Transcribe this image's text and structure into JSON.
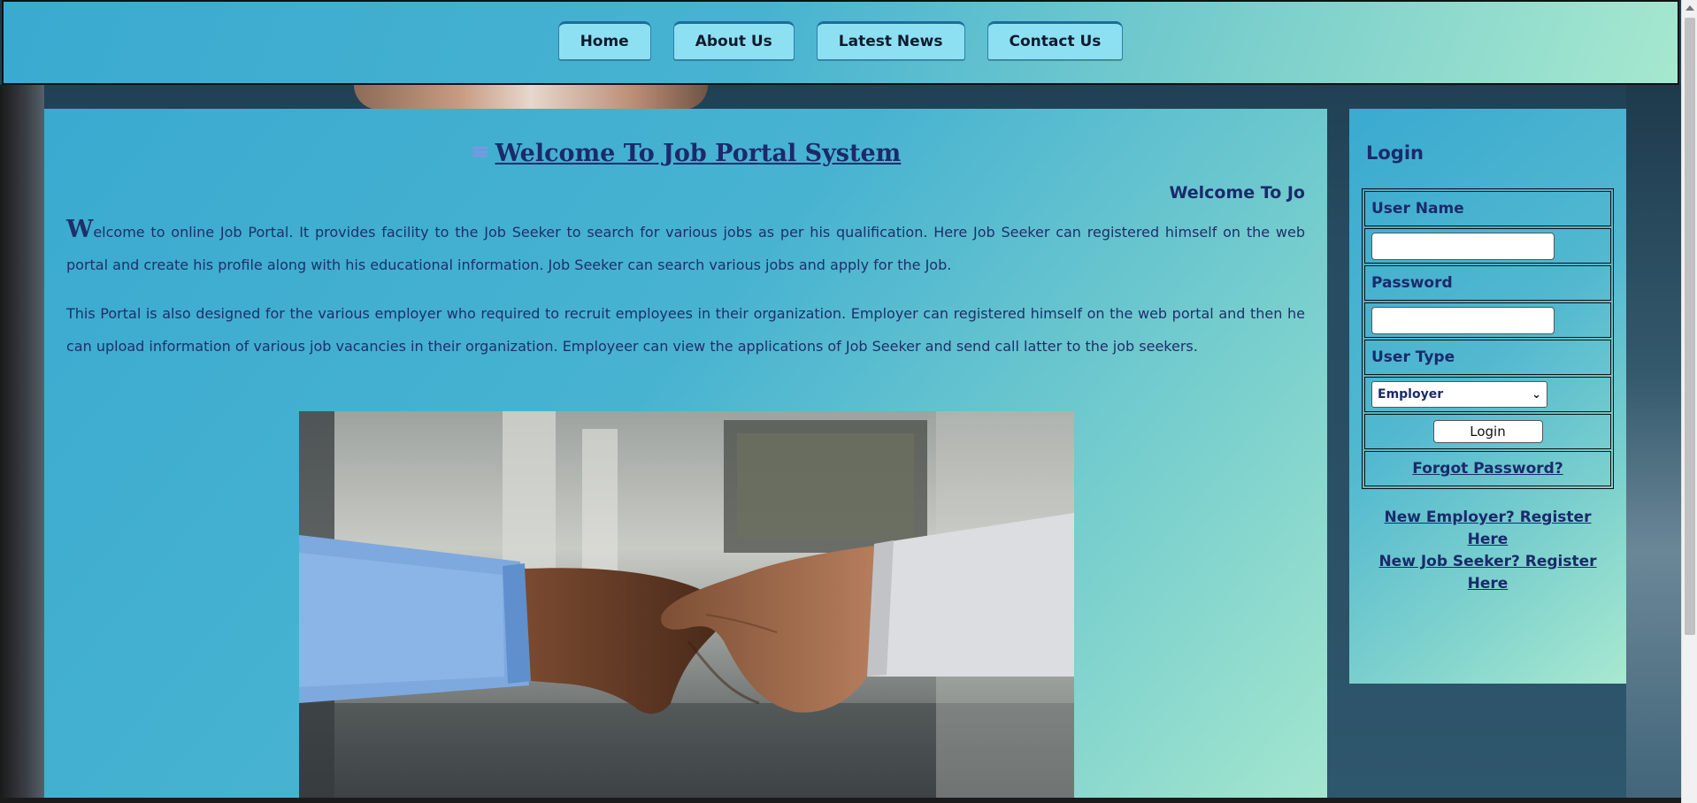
{
  "nav": {
    "items": [
      {
        "label": "Home"
      },
      {
        "label": "About Us"
      },
      {
        "label": "Latest News"
      },
      {
        "label": "Contact Us"
      }
    ]
  },
  "main": {
    "icon": "menu-icon",
    "title": "Welcome To Job Portal System",
    "marquee": "Welcome To Jo",
    "para1_dropcap": "W",
    "para1_rest": "elcome to online Job Portal. It provides facility to the Job Seeker to search for various jobs as per his qualification. Here Job Seeker can registered himself on the web portal and create his profile along with his educational information. Job Seeker can search various jobs and apply for the Job.",
    "para2": "This Portal is also designed for the various employer who required to recruit employees in their organization. Employer can registered himself on the web portal and then he can upload information of various job vacancies in their organization. Employeer can view the applications of Job Seeker and send call latter to the job seekers."
  },
  "login": {
    "heading": "Login",
    "username_label": "User Name",
    "username_value": "",
    "password_label": "Password",
    "password_value": "",
    "usertype_label": "User Type",
    "usertype_selected": "Employer",
    "login_button": "Login",
    "forgot": "Forgot Password?",
    "register_employer": "New Employer? Register Here",
    "register_jobseeker": "New Job Seeker? Register Here"
  },
  "colors": {
    "panel_start": "#3aaad0",
    "panel_end": "#a3e6cf",
    "text": "#1b2a6b",
    "nav_button": "#8de0f2"
  }
}
